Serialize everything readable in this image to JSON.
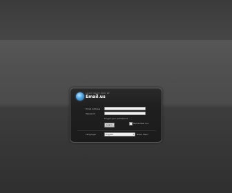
{
  "login": {
    "tagline": "Lorem ipsum dolor sit",
    "brand": "Email.us",
    "email_label": "Email Address",
    "email_value": "",
    "password_label": "Password",
    "password_value": "",
    "forgot_link": "Forgot your password?",
    "login_button": "Log In",
    "remember_label": "Remember me",
    "language_label": "Language",
    "language_selected": "English",
    "help_link": "Need help?"
  },
  "colors": {
    "background": "#4b4b4b",
    "panel": "#1f1f1f",
    "accent": "#4aa6e6"
  }
}
